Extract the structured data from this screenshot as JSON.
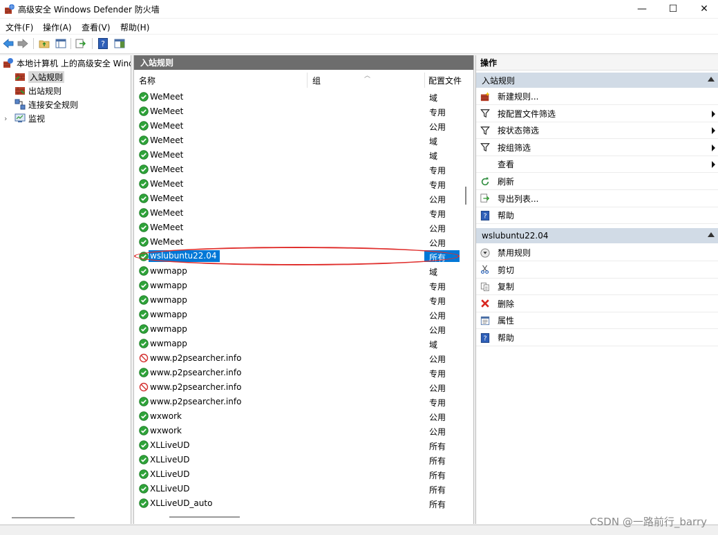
{
  "window": {
    "title": "高级安全 Windows Defender 防火墙",
    "minimize_glyph": "—",
    "maximize_glyph": "☐",
    "close_glyph": "✕"
  },
  "menu": {
    "file": "文件(F)",
    "action": "操作(A)",
    "view": "查看(V)",
    "help": "帮助(H)"
  },
  "tree": {
    "root": "本地计算机 上的高级安全 Wind",
    "items": [
      "入站规则",
      "出站规则",
      "连接安全规则",
      "监视"
    ]
  },
  "center": {
    "header": "入站规则",
    "columns": {
      "name": "名称",
      "group": "组",
      "profile": "配置文件"
    },
    "rows": [
      {
        "name": "WeMeet",
        "profile": "域",
        "status": "allow"
      },
      {
        "name": "WeMeet",
        "profile": "专用",
        "status": "allow"
      },
      {
        "name": "WeMeet",
        "profile": "公用",
        "status": "allow"
      },
      {
        "name": "WeMeet",
        "profile": "域",
        "status": "allow"
      },
      {
        "name": "WeMeet",
        "profile": "域",
        "status": "allow"
      },
      {
        "name": "WeMeet",
        "profile": "专用",
        "status": "allow"
      },
      {
        "name": "WeMeet",
        "profile": "专用",
        "status": "allow"
      },
      {
        "name": "WeMeet",
        "profile": "公用",
        "status": "allow"
      },
      {
        "name": "WeMeet",
        "profile": "专用",
        "status": "allow"
      },
      {
        "name": "WeMeet",
        "profile": "公用",
        "status": "allow"
      },
      {
        "name": "WeMeet",
        "profile": "公用",
        "status": "allow"
      },
      {
        "name": "wslubuntu22.04",
        "profile": "所有",
        "status": "allow",
        "selected": true
      },
      {
        "name": "wwmapp",
        "profile": "域",
        "status": "allow"
      },
      {
        "name": "wwmapp",
        "profile": "专用",
        "status": "allow"
      },
      {
        "name": "wwmapp",
        "profile": "专用",
        "status": "allow"
      },
      {
        "name": "wwmapp",
        "profile": "公用",
        "status": "allow"
      },
      {
        "name": "wwmapp",
        "profile": "公用",
        "status": "allow"
      },
      {
        "name": "wwmapp",
        "profile": "域",
        "status": "allow"
      },
      {
        "name": "www.p2psearcher.info",
        "profile": "公用",
        "status": "block"
      },
      {
        "name": "www.p2psearcher.info",
        "profile": "专用",
        "status": "allow"
      },
      {
        "name": "www.p2psearcher.info",
        "profile": "公用",
        "status": "block"
      },
      {
        "name": "www.p2psearcher.info",
        "profile": "专用",
        "status": "allow"
      },
      {
        "name": "wxwork",
        "profile": "公用",
        "status": "allow"
      },
      {
        "name": "wxwork",
        "profile": "公用",
        "status": "allow"
      },
      {
        "name": "XLLiveUD",
        "profile": "所有",
        "status": "allow"
      },
      {
        "name": "XLLiveUD",
        "profile": "所有",
        "status": "allow"
      },
      {
        "name": "XLLiveUD",
        "profile": "所有",
        "status": "allow"
      },
      {
        "name": "XLLiveUD",
        "profile": "所有",
        "status": "allow"
      },
      {
        "name": "XLLiveUD_auto",
        "profile": "所有",
        "status": "allow"
      }
    ]
  },
  "actions": {
    "header": "操作",
    "section1": "入站规则",
    "section1_items": [
      {
        "label": "新建规则...",
        "icon": "new-rule-icon",
        "submenu": false
      },
      {
        "label": "按配置文件筛选",
        "icon": "filter-icon",
        "submenu": true
      },
      {
        "label": "按状态筛选",
        "icon": "filter-icon",
        "submenu": true
      },
      {
        "label": "按组筛选",
        "icon": "filter-icon",
        "submenu": true
      },
      {
        "label": "查看",
        "icon": "",
        "submenu": true
      },
      {
        "label": "刷新",
        "icon": "refresh-icon",
        "submenu": false
      },
      {
        "label": "导出列表...",
        "icon": "export-icon",
        "submenu": false
      },
      {
        "label": "帮助",
        "icon": "help-icon",
        "submenu": false
      }
    ],
    "section2": "wslubuntu22.04",
    "section2_items": [
      {
        "label": "禁用规则",
        "icon": "disable-icon"
      },
      {
        "label": "剪切",
        "icon": "cut-icon"
      },
      {
        "label": "复制",
        "icon": "copy-icon"
      },
      {
        "label": "删除",
        "icon": "delete-icon"
      },
      {
        "label": "属性",
        "icon": "properties-icon"
      },
      {
        "label": "帮助",
        "icon": "help-icon"
      }
    ]
  },
  "watermark": "CSDN @一路前行_barry"
}
